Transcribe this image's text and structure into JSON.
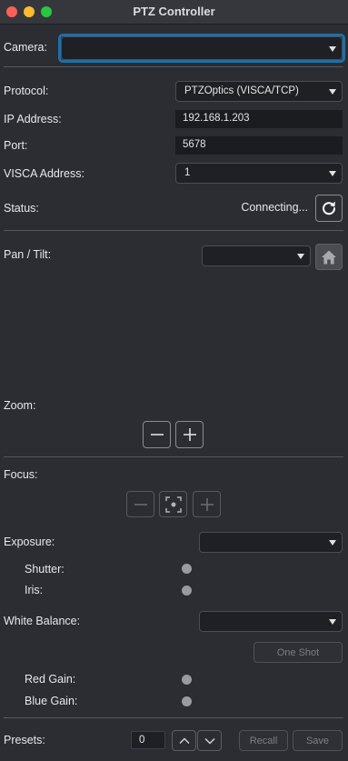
{
  "window": {
    "title": "PTZ Controller"
  },
  "camera": {
    "label": "Camera:",
    "value": ""
  },
  "protocol": {
    "label": "Protocol:",
    "value": "PTZOptics (VISCA/TCP)"
  },
  "ip": {
    "label": "IP Address:",
    "value": "192.168.1.203"
  },
  "port": {
    "label": "Port:",
    "value": "5678"
  },
  "visca": {
    "label": "VISCA Address:",
    "value": "1"
  },
  "status": {
    "label": "Status:",
    "value": "Connecting..."
  },
  "pan_tilt": {
    "label": "Pan / Tilt:",
    "value": ""
  },
  "zoom": {
    "label": "Zoom:"
  },
  "focus": {
    "label": "Focus:"
  },
  "exposure": {
    "label": "Exposure:",
    "value": "",
    "shutter_label": "Shutter:",
    "iris_label": "Iris:"
  },
  "white_balance": {
    "label": "White Balance:",
    "value": "",
    "one_shot_label": "One Shot",
    "red_gain_label": "Red Gain:",
    "blue_gain_label": "Blue Gain:"
  },
  "presets": {
    "label": "Presets:",
    "value": "0",
    "recall_label": "Recall",
    "save_label": "Save"
  },
  "colors": {
    "background": "#2b2d33",
    "focus_ring": "#1f6fa8",
    "divider": "#55575d"
  }
}
